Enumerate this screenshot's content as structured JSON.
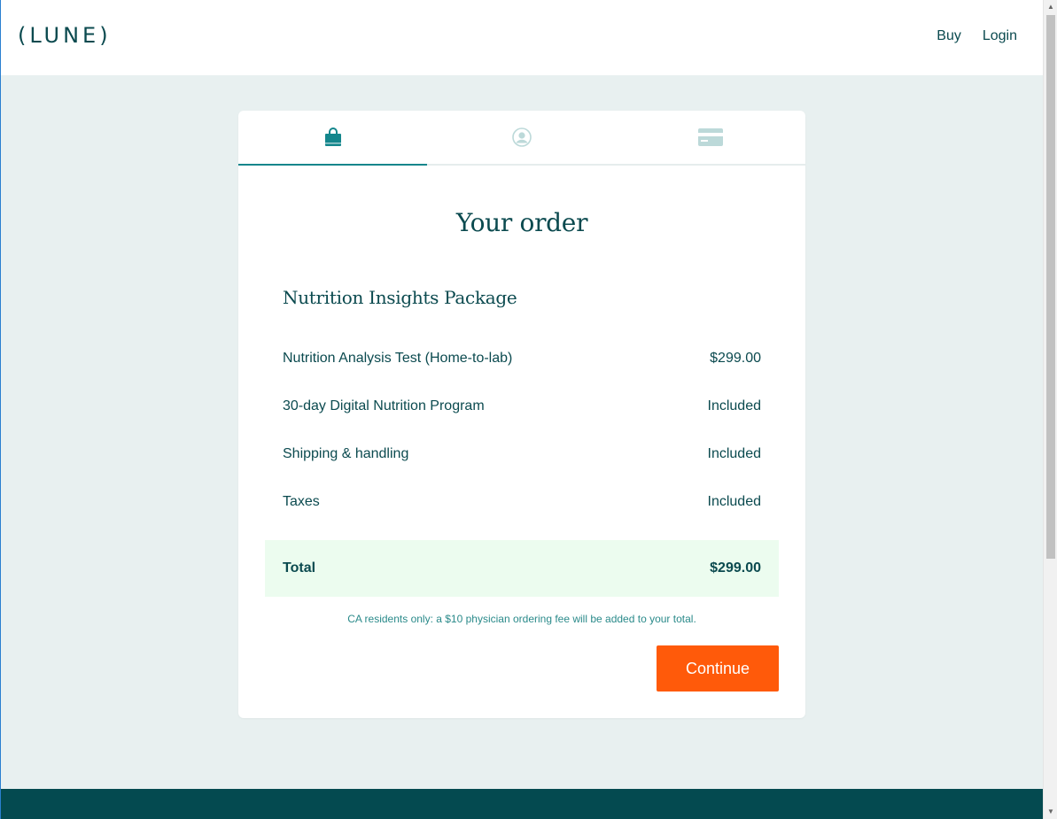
{
  "header": {
    "logo": "(LUNE)",
    "nav": {
      "buy": "Buy",
      "login": "Login"
    }
  },
  "steps": [
    {
      "icon": "shopping-bag-icon",
      "active": true
    },
    {
      "icon": "user-icon",
      "active": false
    },
    {
      "icon": "credit-card-icon",
      "active": false
    }
  ],
  "order": {
    "title": "Your order",
    "package_name": "Nutrition Insights Package",
    "items": [
      {
        "label": "Nutrition Analysis Test (Home-to-lab)",
        "value": "$299.00"
      },
      {
        "label": "30-day Digital Nutrition Program",
        "value": "Included"
      },
      {
        "label": "Shipping & handling",
        "value": "Included"
      },
      {
        "label": "Taxes",
        "value": "Included"
      }
    ],
    "total_label": "Total",
    "total_value": "$299.00",
    "note": "CA residents only: a $10 physician ordering fee will be added to your total.",
    "continue_label": "Continue"
  },
  "colors": {
    "brand_teal": "#0b4a4f",
    "accent_teal": "#14868c",
    "cta_orange": "#ff5a0a",
    "total_bg": "#ecfcef",
    "page_bg": "#e8f0f0",
    "footer_bg": "#044a50"
  }
}
